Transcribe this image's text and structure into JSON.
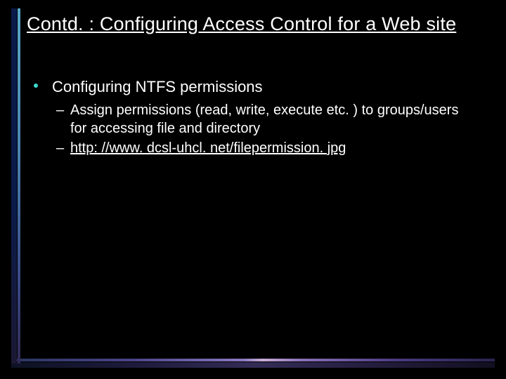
{
  "title": "Contd. : Configuring Access Control for a Web site",
  "bullets": {
    "l1_1": "Configuring NTFS permissions",
    "l2_1": "Assign permissions (read, write, execute etc. ) to groups/users for accessing file and directory",
    "l2_2": "http: //www. dcsl-uhcl. net/filepermission. jpg"
  }
}
